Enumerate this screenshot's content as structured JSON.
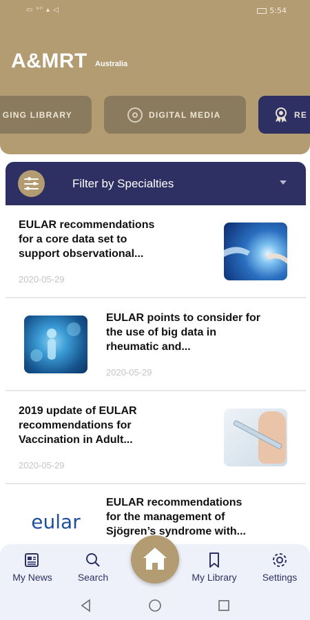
{
  "status_bar": {
    "left": "▭ ᵃˡˡ ▴ ◁",
    "time": "5:54",
    "battery_icon": "battery-icon"
  },
  "header": {
    "title": "A&MRT",
    "subtitle": "Australia"
  },
  "chips": [
    {
      "label": "GING LIBRARY"
    },
    {
      "label": "DIGITAL MEDIA",
      "icon": "target-icon"
    },
    {
      "label": "RE",
      "icon": "award-icon"
    }
  ],
  "filter": {
    "label": "Filter by Specialties",
    "icon": "sliders-icon"
  },
  "articles": [
    {
      "title_lines": [
        "EULAR recommendations",
        "for a core data set to",
        "support observational..."
      ],
      "date": "2020-05-29",
      "image": "hands-image"
    },
    {
      "title_lines": [
        "EULAR points to consider for",
        "the use of big data in",
        "rheumatic and..."
      ],
      "date": "2020-05-29",
      "image": "medical-tech-image"
    },
    {
      "title_lines": [
        "2019 update of EULAR",
        "recommendations for",
        "Vaccination in Adult..."
      ],
      "date": "2020-05-29",
      "image": "syringe-image"
    },
    {
      "title_lines": [
        "EULAR recommendations",
        "for the management of",
        "Sjögren’s syndrome with..."
      ],
      "image_text": "eular"
    }
  ],
  "nav": {
    "items": [
      {
        "label": "My News",
        "icon": "newspaper-icon"
      },
      {
        "label": "Search",
        "icon": "search-icon"
      },
      {
        "label": "My Library",
        "icon": "bookmark-icon"
      },
      {
        "label": "Settings",
        "icon": "gear-icon"
      }
    ],
    "home_icon": "home-icon"
  },
  "colors": {
    "brand_gold": "#b39b72",
    "brand_navy": "#2e3063",
    "eular_blue": "#1c4f9e"
  }
}
